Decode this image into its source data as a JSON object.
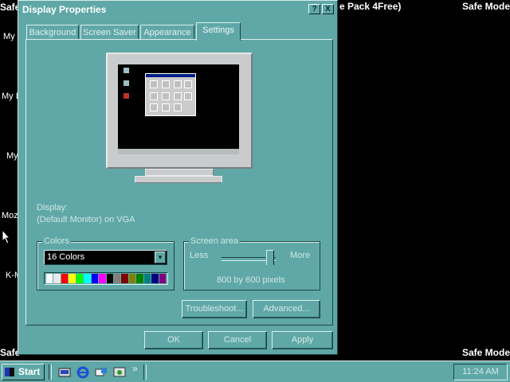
{
  "desktop": {
    "icons": [
      "My",
      "My D",
      "My",
      "Moz",
      "K-M"
    ],
    "banner_text": "e Pack 4Free)",
    "safe_mode": "Safe Mode",
    "safe_left_top": "Safe",
    "safe_left_bottom": "Safe"
  },
  "dialog": {
    "title": "Display Properties",
    "help_label": "?",
    "close_label": "X",
    "tabs": [
      {
        "label": "Background"
      },
      {
        "label": "Screen Saver"
      },
      {
        "label": "Appearance"
      },
      {
        "label": "Settings",
        "active": true
      }
    ],
    "display_label": "Display:",
    "display_value": "(Default Monitor) on VGA",
    "colors": {
      "group_label": "Colors",
      "selected": "16 Colors",
      "palette": [
        "#ffffff",
        "#e8e8e8",
        "#ff0000",
        "#ffff00",
        "#00ff00",
        "#00ffff",
        "#0000ff",
        "#ff00ff",
        "#000000",
        "#808080",
        "#800000",
        "#808000",
        "#008000",
        "#008080",
        "#000080",
        "#800080"
      ]
    },
    "screen_area": {
      "group_label": "Screen area",
      "less": "Less",
      "more": "More",
      "value_text": "800 by 600 pixels",
      "slider_level": 0.9
    },
    "buttons": {
      "troubleshoot": "Troubleshoot...",
      "advanced": "Advanced...",
      "ok": "OK",
      "cancel": "Cancel",
      "apply": "Apply"
    }
  },
  "taskbar": {
    "start_label": "Start",
    "chevron": "»",
    "clock": "11:24 AM"
  }
}
